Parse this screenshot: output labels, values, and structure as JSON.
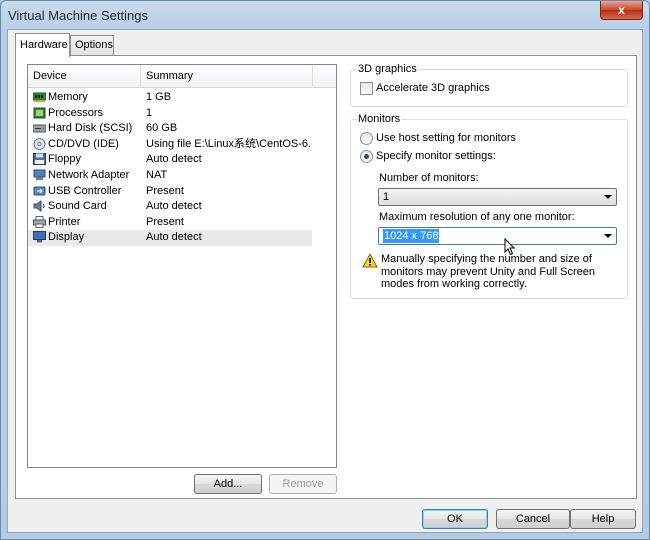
{
  "window": {
    "title": "Virtual Machine Settings",
    "close_glyph": "x"
  },
  "tabs": [
    {
      "label": "Hardware",
      "active": true
    },
    {
      "label": "Options",
      "active": false
    }
  ],
  "device_list": {
    "columns": [
      "Device",
      "Summary"
    ],
    "rows": [
      {
        "device": "Memory",
        "summary": "1 GB",
        "icon": "memory-icon"
      },
      {
        "device": "Processors",
        "summary": "1",
        "icon": "processor-icon"
      },
      {
        "device": "Hard Disk (SCSI)",
        "summary": "60 GB",
        "icon": "hard-disk-icon"
      },
      {
        "device": "CD/DVD (IDE)",
        "summary": "Using file E:\\Linux系统\\CentOS-6...",
        "icon": "cd-dvd-icon"
      },
      {
        "device": "Floppy",
        "summary": "Auto detect",
        "icon": "floppy-icon"
      },
      {
        "device": "Network Adapter",
        "summary": "NAT",
        "icon": "network-adapter-icon"
      },
      {
        "device": "USB Controller",
        "summary": "Present",
        "icon": "usb-icon"
      },
      {
        "device": "Sound Card",
        "summary": "Auto detect",
        "icon": "sound-card-icon"
      },
      {
        "device": "Printer",
        "summary": "Present",
        "icon": "printer-icon"
      },
      {
        "device": "Display",
        "summary": "Auto detect",
        "icon": "display-icon",
        "selected": true
      }
    ]
  },
  "list_buttons": {
    "add": "Add...",
    "remove": "Remove"
  },
  "graphics": {
    "title": "3D graphics",
    "accelerate_label": "Accelerate 3D graphics",
    "accelerate_checked": false
  },
  "monitors": {
    "title": "Monitors",
    "host_setting_label": "Use host setting for monitors",
    "specify_label": "Specify monitor settings:",
    "selected_option": "specify",
    "number_label": "Number of monitors:",
    "number_value": "1",
    "resolution_label": "Maximum resolution of any one monitor:",
    "resolution_value": "1024 x 768",
    "warning_text": "Manually specifying the number and size of monitors may prevent Unity and Full Screen modes from working correctly."
  },
  "dialog_buttons": {
    "ok": "OK",
    "cancel": "Cancel",
    "help": "Help"
  },
  "colors": {
    "selection": "#3399ff",
    "title_bar": "#c9dbee",
    "close_button": "#c7452b"
  }
}
